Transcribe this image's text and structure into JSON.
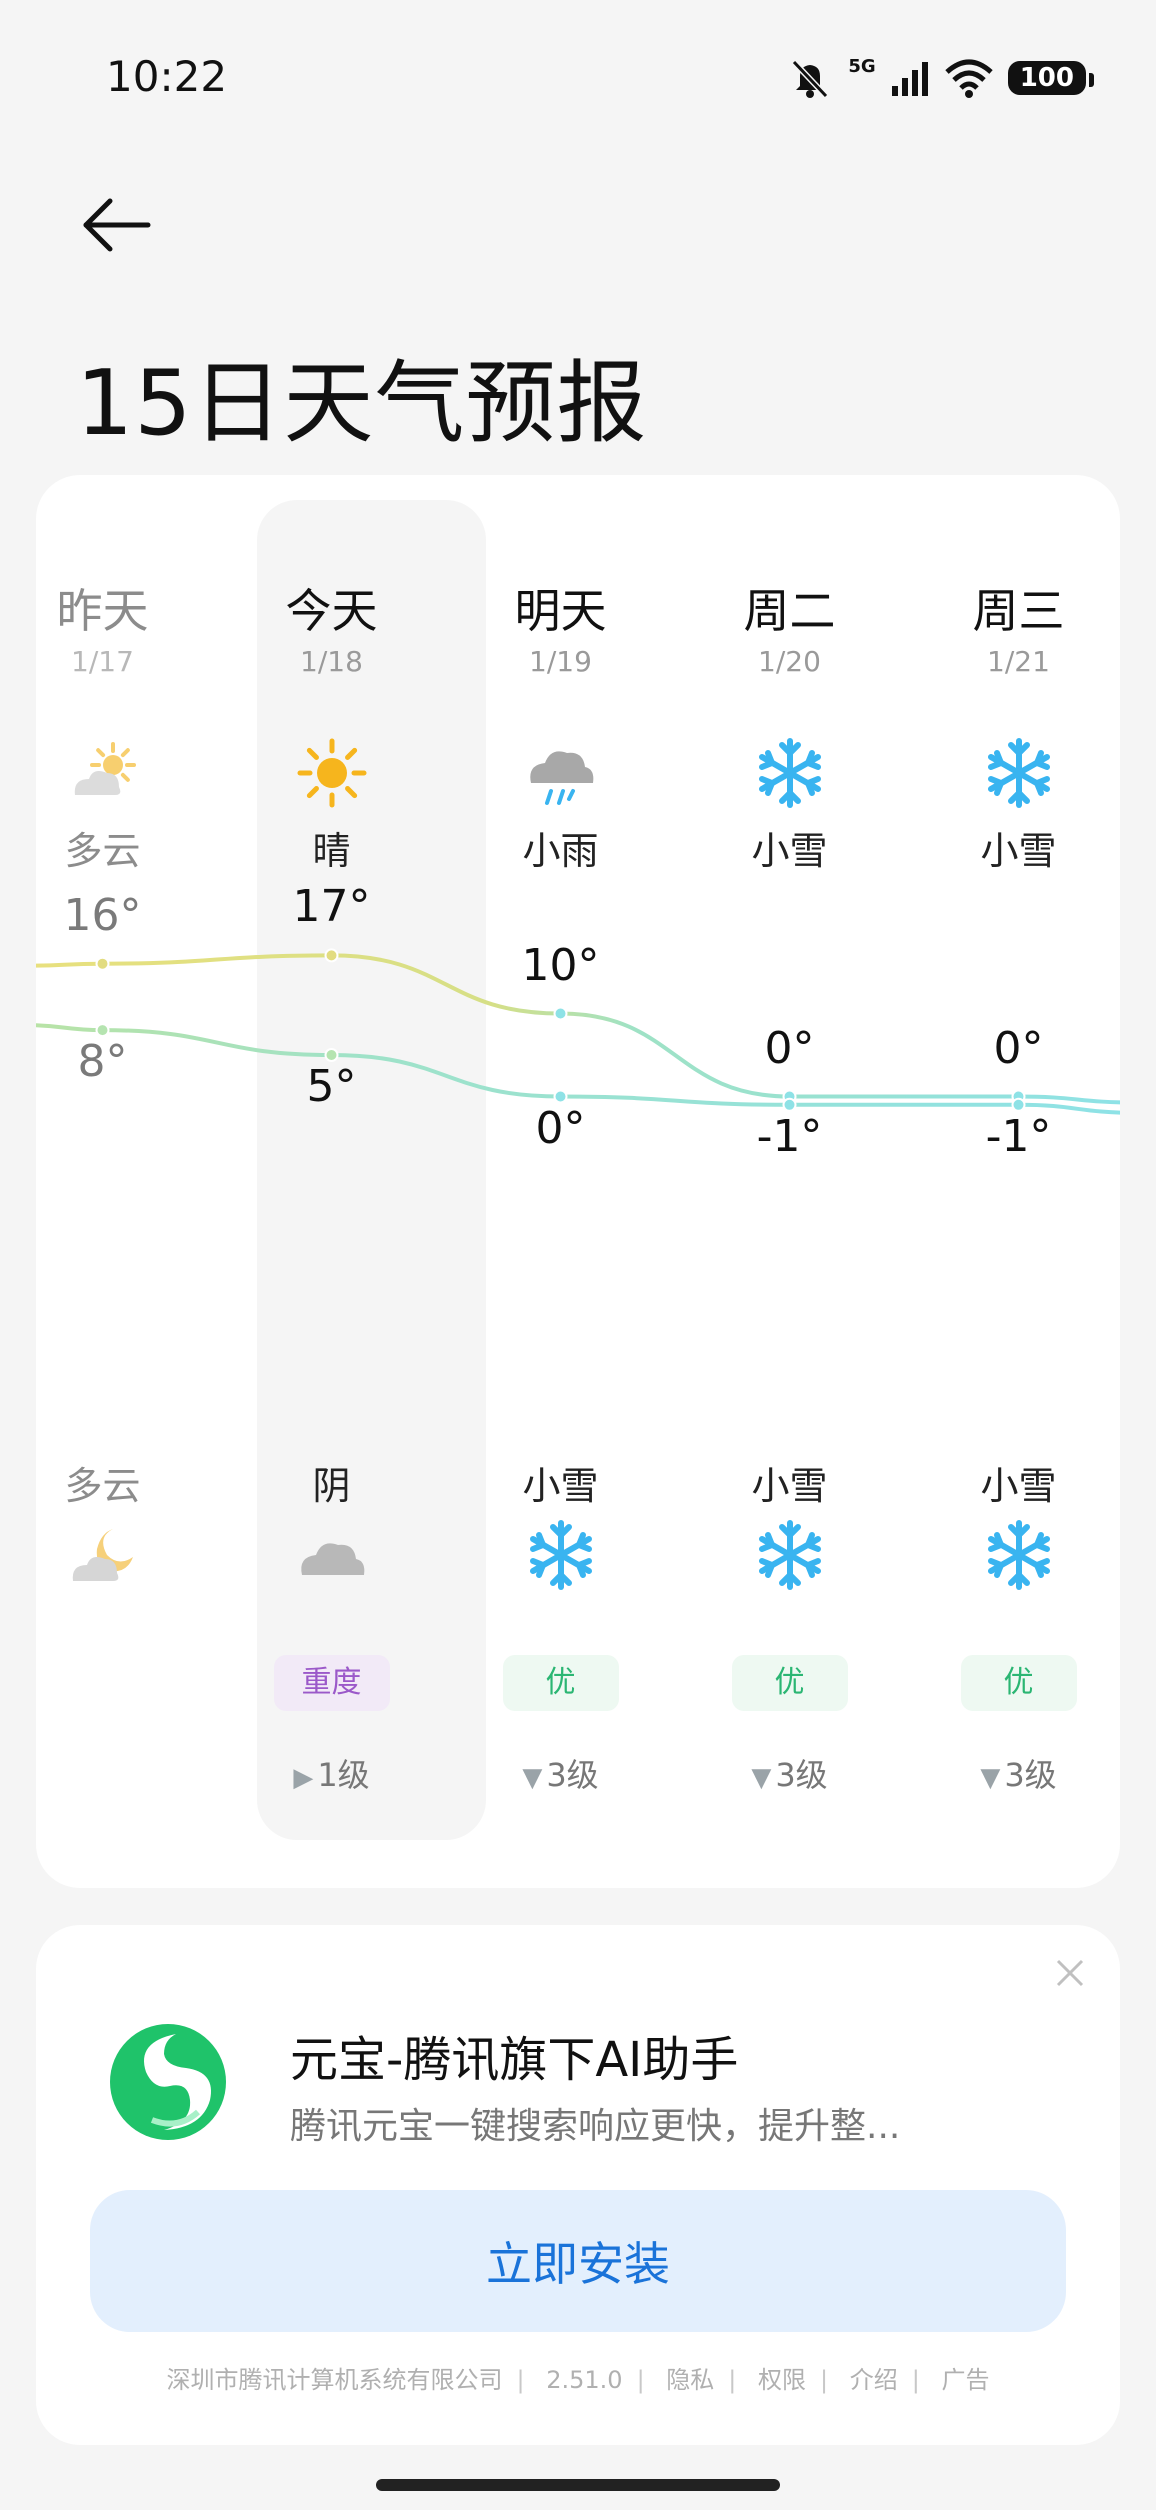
{
  "status_bar": {
    "time": "10:22",
    "network": "5G",
    "battery": "100"
  },
  "page": {
    "title": "15日天气预报"
  },
  "forecast": {
    "days": [
      {
        "key": "yesterday",
        "day": "昨天",
        "date": "1/17",
        "day_weather": "多云",
        "day_icon": "partly-cloudy-day-icon",
        "high": "16°",
        "low": "8°",
        "night_weather": "多云",
        "night_icon": "partly-cloudy-night-icon",
        "air_quality": "",
        "wind_dir": "",
        "wind": ""
      },
      {
        "key": "today",
        "day": "今天",
        "date": "1/18",
        "day_weather": "晴",
        "day_icon": "sun-icon",
        "high": "17°",
        "low": "5°",
        "night_weather": "阴",
        "night_icon": "cloud-icon",
        "air_quality": "重度",
        "wind_dir": "▶",
        "wind": "1级"
      },
      {
        "key": "tomorrow",
        "day": "明天",
        "date": "1/19",
        "day_weather": "小雨",
        "day_icon": "rain-icon",
        "high": "10°",
        "low": "0°",
        "night_weather": "小雪",
        "night_icon": "snowflake-icon",
        "air_quality": "优",
        "wind_dir": "▼",
        "wind": "3级"
      },
      {
        "key": "tue",
        "day": "周二",
        "date": "1/20",
        "day_weather": "小雪",
        "day_icon": "snowflake-icon",
        "high": "0°",
        "low": "-1°",
        "night_weather": "小雪",
        "night_icon": "snowflake-icon",
        "air_quality": "优",
        "wind_dir": "▼",
        "wind": "3级"
      },
      {
        "key": "wed",
        "day": "周三",
        "date": "1/21",
        "day_weather": "小雪",
        "day_icon": "snowflake-icon",
        "high": "0°",
        "low": "-1°",
        "night_weather": "小雪",
        "night_icon": "snowflake-icon",
        "air_quality": "优",
        "wind_dir": "▼",
        "wind": "3级"
      }
    ],
    "colors": {
      "high_line": "#e6dc82",
      "low_line": "#8fe3e6",
      "good": "#2bb673",
      "bad": "#9b59c9"
    }
  },
  "chart_data": {
    "type": "line",
    "categories": [
      "昨天",
      "今天",
      "明天",
      "周二",
      "周三"
    ],
    "series": [
      {
        "values": [
          16,
          17,
          10,
          0,
          0
        ]
      },
      {
        "values": [
          8,
          5,
          0,
          -1,
          -1
        ]
      }
    ]
  },
  "ad": {
    "title": "元宝-腾讯旗下AI助手",
    "description": "腾讯元宝一键搜索响应更快，提升整...",
    "install_label": "立即安装",
    "footer": [
      "深圳市腾讯计算机系统有限公司",
      "2.51.0",
      "隐私",
      "权限",
      "介绍",
      "广告"
    ]
  }
}
